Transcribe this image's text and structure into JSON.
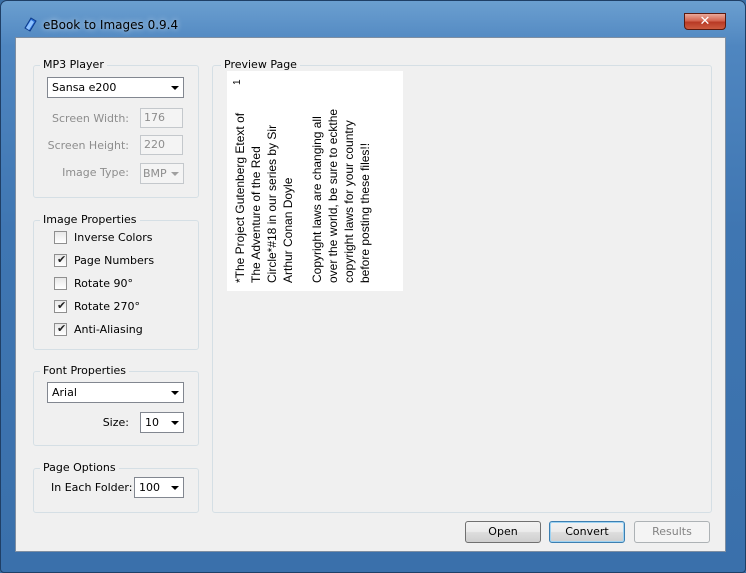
{
  "window": {
    "title": "eBook to Images 0.9.4"
  },
  "mp3_player": {
    "group_label": "MP3 Player",
    "device": "Sansa e200",
    "screen_width_label": "Screen Width:",
    "screen_width": "176",
    "screen_height_label": "Screen Height:",
    "screen_height": "220",
    "image_type_label": "Image Type:",
    "image_type": "BMP"
  },
  "image_properties": {
    "group_label": "Image Properties",
    "options": [
      {
        "label": "Inverse Colors",
        "checked": false
      },
      {
        "label": "Page Numbers",
        "checked": true
      },
      {
        "label": "Rotate 90°",
        "checked": false
      },
      {
        "label": "Rotate 270°",
        "checked": true
      },
      {
        "label": "Anti-Aliasing",
        "checked": true
      }
    ]
  },
  "font_properties": {
    "group_label": "Font Properties",
    "font": "Arial",
    "size_label": "Size:",
    "size": "10"
  },
  "page_options": {
    "group_label": "Page Options",
    "folder_label": "In Each Folder:",
    "folder_count": "100"
  },
  "preview": {
    "group_label": "Preview Page",
    "page_number": "1",
    "paragraphs": [
      "*The Project Gutenberg Etext of The Adventure of the Red Circle*#18 in our series by Sir Arthur Conan Doyle",
      "Copyright laws are changing all over the world, be sure to eckthe copyright laws for your country before posting these files!!"
    ]
  },
  "buttons": {
    "open": "Open",
    "convert": "Convert",
    "results": "Results"
  }
}
